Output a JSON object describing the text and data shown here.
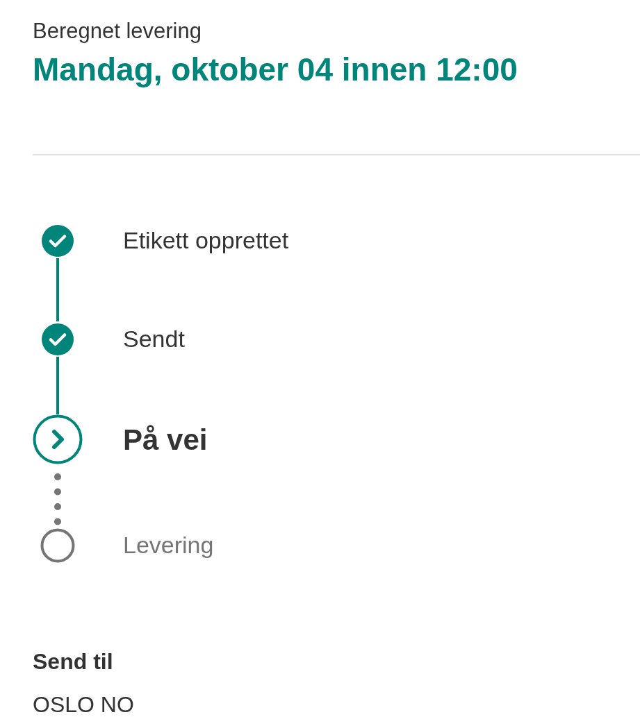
{
  "estimate": {
    "label": "Beregnet levering",
    "date": "Mandag, oktober 04 innen 12:00"
  },
  "steps": [
    {
      "label": "Etikett opprettet",
      "kind": "done"
    },
    {
      "label": "Sendt",
      "kind": "done"
    },
    {
      "label": "På vei",
      "kind": "current"
    },
    {
      "label": "Levering",
      "kind": "pending"
    }
  ],
  "ship_to": {
    "label": "Send til",
    "value": "OSLO NO"
  }
}
